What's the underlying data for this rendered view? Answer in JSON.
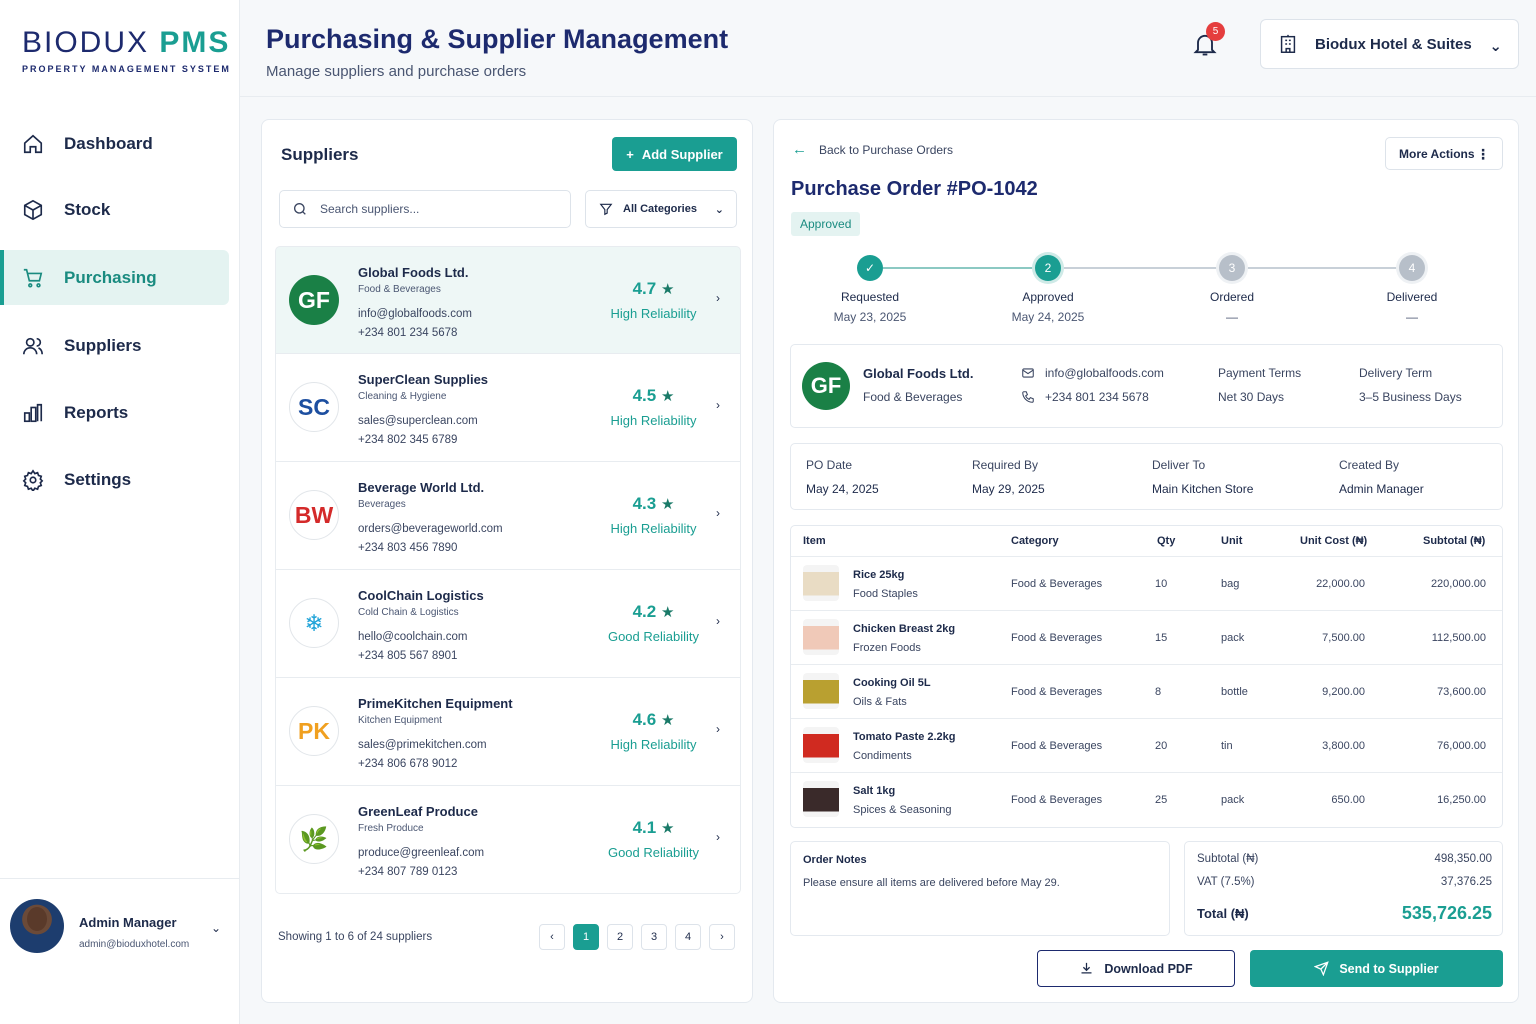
{
  "brand": {
    "name_main": "BIODUX",
    "name_accent": "PMS",
    "tagline": "PROPERTY MANAGEMENT SYSTEM"
  },
  "nav": [
    {
      "label": "Dashboard",
      "icon": "home-icon",
      "active": false
    },
    {
      "label": "Stock",
      "icon": "box-icon",
      "active": false
    },
    {
      "label": "Purchasing",
      "icon": "cart-icon",
      "active": true
    },
    {
      "label": "Suppliers",
      "icon": "users-icon",
      "active": false
    },
    {
      "label": "Reports",
      "icon": "bar-chart-icon",
      "active": false
    },
    {
      "label": "Settings",
      "icon": "gear-icon",
      "active": false
    }
  ],
  "user": {
    "name": "Admin Manager",
    "email": "admin@bioduxhotel.com"
  },
  "header": {
    "title": "Purchasing & Supplier Management",
    "subtitle": "Manage suppliers and purchase orders",
    "notification_count": "5",
    "hotel": "Biodux Hotel & Suites"
  },
  "suppliers_panel": {
    "title": "Suppliers",
    "add_label": "Add Supplier",
    "search_placeholder": "Search suppliers...",
    "filter_label": "All Categories",
    "showing": "Showing 1 to 6 of 24 suppliers",
    "pages": [
      "1",
      "2",
      "3",
      "4"
    ],
    "current_page": "1"
  },
  "suppliers": [
    {
      "initials": "GF",
      "name": "Global Foods Ltd.",
      "category": "Food & Beverages",
      "email": "info@globalfoods.com",
      "phone": "+234 801 234 5678",
      "rating": "4.7",
      "reliability": "High Reliability",
      "color": "#1a8046",
      "selected": true
    },
    {
      "initials": "SC",
      "name": "SuperClean Supplies",
      "category": "Cleaning & Hygiene",
      "email": "sales@superclean.com",
      "phone": "+234 802 345 6789",
      "rating": "4.5",
      "reliability": "High Reliability",
      "color": "#1d4fa0",
      "selected": false
    },
    {
      "initials": "BW",
      "name": "Beverage World Ltd.",
      "category": "Beverages",
      "email": "orders@beverageworld.com",
      "phone": "+234 803 456 7890",
      "rating": "4.3",
      "reliability": "High Reliability",
      "color": "#d42a2a",
      "selected": false
    },
    {
      "initials": "❄",
      "name": "CoolChain Logistics",
      "category": "Cold Chain & Logistics",
      "email": "hello@coolchain.com",
      "phone": "+234 805 567 8901",
      "rating": "4.2",
      "reliability": "Good Reliability",
      "color": "#1fa3d8",
      "selected": false
    },
    {
      "initials": "PK",
      "name": "PrimeKitchen Equipment",
      "category": "Kitchen Equipment",
      "email": "sales@primekitchen.com",
      "phone": "+234 806 678 9012",
      "rating": "4.6",
      "reliability": "High Reliability",
      "color": "#f0a020",
      "selected": false
    },
    {
      "initials": "🌿",
      "name": "GreenLeaf Produce",
      "category": "Fresh Produce",
      "email": "produce@greenleaf.com",
      "phone": "+234 807 789 0123",
      "rating": "4.1",
      "reliability": "Good Reliability",
      "color": "#2e8b3a",
      "selected": false
    }
  ],
  "po": {
    "back_label": "Back to Purchase Orders",
    "more_label": "More Actions",
    "title": "Purchase Order #PO-1042",
    "status": "Approved",
    "steps": [
      {
        "label": "Requested",
        "date": "May 23, 2025",
        "state": "done",
        "num": "✓"
      },
      {
        "label": "Approved",
        "date": "May 24, 2025",
        "state": "current",
        "num": "2"
      },
      {
        "label": "Ordered",
        "date": "—",
        "state": "todo",
        "num": "3"
      },
      {
        "label": "Delivered",
        "date": "—",
        "state": "todo",
        "num": "4"
      }
    ],
    "supplier": {
      "initials": "GF",
      "name": "Global Foods Ltd.",
      "category": "Food & Beverages",
      "email": "info@globalfoods.com",
      "phone": "+234 801 234 5678",
      "payment_terms_label": "Payment Terms",
      "payment_terms": "Net 30 Days",
      "delivery_term_label": "Delivery Term",
      "delivery_term": "3–5 Business Days"
    },
    "meta": [
      {
        "label": "PO Date",
        "value": "May 24, 2025"
      },
      {
        "label": "Required By",
        "value": "May 29, 2025"
      },
      {
        "label": "Deliver To",
        "value": "Main Kitchen Store"
      },
      {
        "label": "Created By",
        "value": "Admin Manager"
      }
    ],
    "columns": [
      "Item",
      "Category",
      "Qty",
      "Unit",
      "Unit Cost (₦)",
      "Subtotal (₦)"
    ],
    "items": [
      {
        "name": "Rice 25kg",
        "sub": "Food Staples",
        "category": "Food & Beverages",
        "qty": "10",
        "unit": "bag",
        "unit_cost": "22,000.00",
        "subtotal": "220,000.00",
        "thumb": "#e9dcc4"
      },
      {
        "name": "Chicken Breast 2kg",
        "sub": "Frozen Foods",
        "category": "Food & Beverages",
        "qty": "15",
        "unit": "pack",
        "unit_cost": "7,500.00",
        "subtotal": "112,500.00",
        "thumb": "#f0c9b8"
      },
      {
        "name": "Cooking Oil 5L",
        "sub": "Oils & Fats",
        "category": "Food & Beverages",
        "qty": "8",
        "unit": "bottle",
        "unit_cost": "9,200.00",
        "subtotal": "73,600.00",
        "thumb": "#b9a030"
      },
      {
        "name": "Tomato Paste 2.2kg",
        "sub": "Condiments",
        "category": "Food & Beverages",
        "qty": "20",
        "unit": "tin",
        "unit_cost": "3,800.00",
        "subtotal": "76,000.00",
        "thumb": "#d02a20"
      },
      {
        "name": "Salt 1kg",
        "sub": "Spices & Seasoning",
        "category": "Food & Beverages",
        "qty": "25",
        "unit": "pack",
        "unit_cost": "650.00",
        "subtotal": "16,250.00",
        "thumb": "#3a2a2a"
      }
    ],
    "notes_title": "Order Notes",
    "notes": "Please ensure all items are delivered before May 29.",
    "subtotal_label": "Subtotal (₦)",
    "subtotal": "498,350.00",
    "vat_label": "VAT (7.5%)",
    "vat": "37,376.25",
    "total_label": "Total (₦)",
    "total": "535,726.25",
    "download_label": "Download PDF",
    "send_label": "Send to Supplier"
  }
}
